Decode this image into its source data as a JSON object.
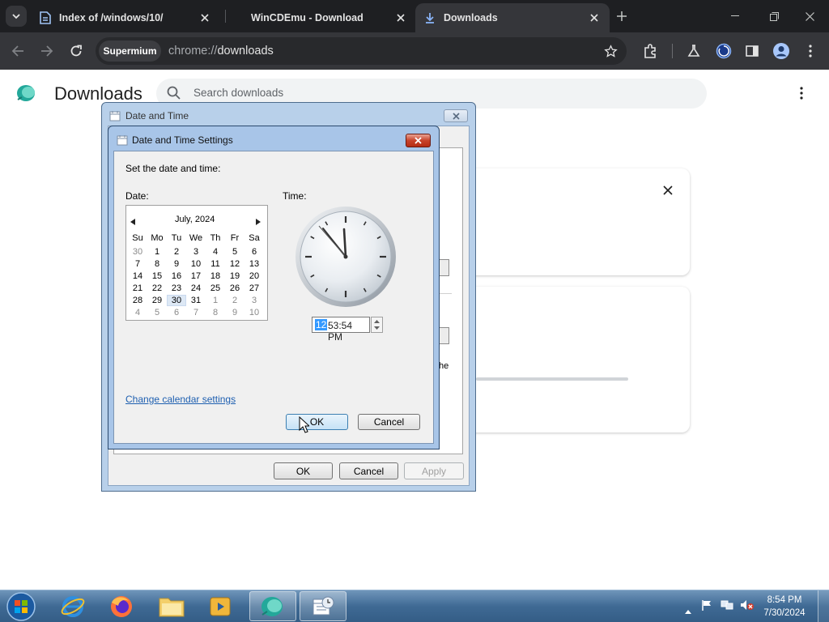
{
  "browser": {
    "tabs": [
      {
        "label": "Index of /windows/10/",
        "icon": "document-icon"
      },
      {
        "label": "WinCDEmu - Download",
        "icon": "globe-icon"
      },
      {
        "label": "Downloads",
        "icon": "download-icon",
        "active": true
      }
    ],
    "profile_chip": "Supermium",
    "url_scheme": "chrome://",
    "url_path": "downloads"
  },
  "downloads_page": {
    "title": "Downloads",
    "search_placeholder": "Search downloads",
    "card_text_fragment": "he"
  },
  "datetime_dialog": {
    "title": "Date and Time",
    "ok": "OK",
    "cancel": "Cancel",
    "apply": "Apply"
  },
  "settings_dialog": {
    "title": "Date and Time Settings",
    "instruction": "Set the date and time:",
    "date_label": "Date:",
    "time_label": "Time:",
    "month_year": "July, 2024",
    "weekdays": [
      "Su",
      "Mo",
      "Tu",
      "We",
      "Th",
      "Fr",
      "Sa"
    ],
    "weeks": [
      [
        "30",
        "1",
        "2",
        "3",
        "4",
        "5",
        "6"
      ],
      [
        "7",
        "8",
        "9",
        "10",
        "11",
        "12",
        "13"
      ],
      [
        "14",
        "15",
        "16",
        "17",
        "18",
        "19",
        "20"
      ],
      [
        "21",
        "22",
        "23",
        "24",
        "25",
        "26",
        "27"
      ],
      [
        "28",
        "29",
        "30",
        "31",
        "1",
        "2",
        "3"
      ],
      [
        "4",
        "5",
        "6",
        "7",
        "8",
        "9",
        "10"
      ]
    ],
    "selected_day": "30",
    "time_hour": "12",
    "time_rest": "53:54 PM",
    "link": "Change calendar settings",
    "ok": "OK",
    "cancel": "Cancel"
  },
  "taskbar": {
    "clock_time": "8:54 PM",
    "clock_date": "7/30/2024"
  },
  "colors": {
    "accent": "#3399ff",
    "taskbar": "#3f6a94",
    "browser_frame": "#1e1f22"
  }
}
